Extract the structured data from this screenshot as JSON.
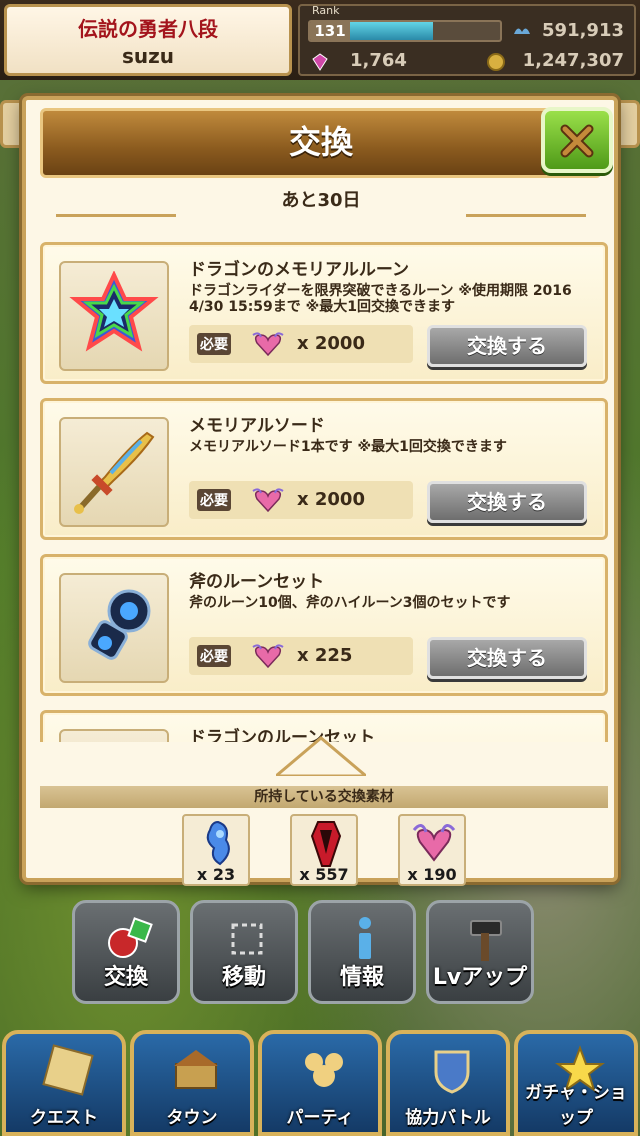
{
  "topbar": {
    "rank_title": "伝説の勇者八段",
    "player_name": "suzu",
    "rank_label": "Rank",
    "rank_value": "131",
    "rank_progress": 0.55,
    "stamina": "591,913",
    "gems": "1,764",
    "gold": "1,247,307"
  },
  "dialog": {
    "title": "交換",
    "remaining": "あと30日"
  },
  "items": [
    {
      "name": "ドラゴンのメモリアルルーン",
      "desc": "ドラゴンライダーを限界突破できるルーン ※使用期限 2016 4/30 15:59まで ※最大1回交換できます",
      "req_label": "必要",
      "req_count": "x 2000",
      "button": "交換する",
      "icon": "star-rune-icon"
    },
    {
      "name": "メモリアルソード",
      "desc": "メモリアルソード1本です ※最大1回交換できます",
      "req_label": "必要",
      "req_count": "x 2000",
      "button": "交換する",
      "icon": "sword-icon"
    },
    {
      "name": "斧のルーンセット",
      "desc": "斧のルーン10個、斧のハイルーン3個のセットです",
      "req_label": "必要",
      "req_count": "x 225",
      "button": "交換する",
      "icon": "axe-rune-icon"
    },
    {
      "name": "ドラゴンのルーンセット",
      "desc": "",
      "req_label": "",
      "req_count": "",
      "button": "",
      "icon": "dragon-rune-icon"
    }
  ],
  "owned": {
    "title": "所持している交換素材",
    "materials": [
      {
        "icon": "blue-spirit-icon",
        "count": "x 23"
      },
      {
        "icon": "red-crest-icon",
        "count": "x 557"
      },
      {
        "icon": "winged-heart-icon",
        "count": "x 190"
      }
    ]
  },
  "mid_nav": [
    {
      "label": "交換",
      "icon": "exchange-icon"
    },
    {
      "label": "移動",
      "icon": "move-icon"
    },
    {
      "label": "情報",
      "icon": "info-icon"
    },
    {
      "label": "Lvアップ",
      "icon": "hammer-icon"
    }
  ],
  "bottom_nav": [
    {
      "label": "クエスト",
      "icon": "quest-icon"
    },
    {
      "label": "タウン",
      "icon": "town-icon"
    },
    {
      "label": "パーティ",
      "icon": "party-icon"
    },
    {
      "label": "協力バトル",
      "icon": "coop-battle-icon"
    },
    {
      "label": "ガチャ・ショップ",
      "icon": "gacha-shop-icon"
    }
  ]
}
